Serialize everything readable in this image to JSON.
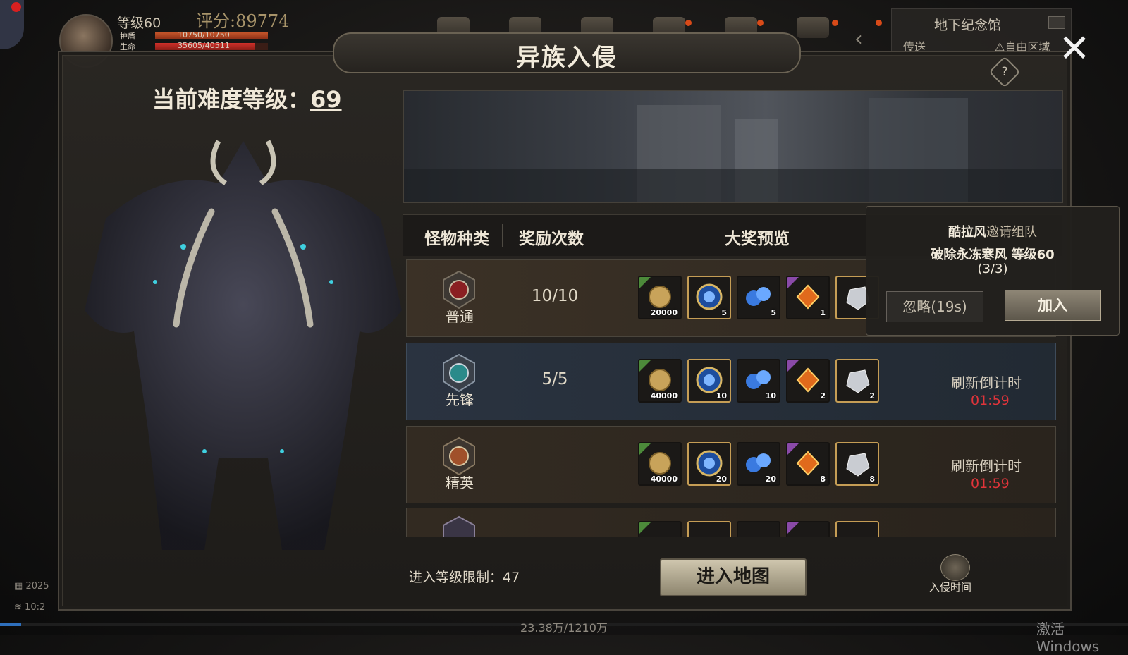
{
  "hud": {
    "level": "等级60",
    "score": "评分:89774",
    "shield_label": "护盾",
    "shield_value": "10750/10750",
    "shield_fraction": 1.0,
    "hp_label": "生命",
    "hp_value": "35605/40511",
    "hp_fraction": 0.879,
    "map_title": "地下纪念馆",
    "teleport": "传送",
    "pvp_zone": "自由区域",
    "date_partial": "2025",
    "time_partial": "10:2"
  },
  "panel": {
    "title": "异族入侵",
    "difficulty_label": "当前难度等级：",
    "difficulty_value": "69"
  },
  "table": {
    "headers": [
      "怪物种类",
      "奖励次数",
      "大奖预览"
    ],
    "rows": [
      {
        "name": "普通",
        "count": "10/10",
        "emblem_color": "#8a1f22",
        "items": [
          {
            "icon": "gold-coin-icon",
            "qty": "20000"
          },
          {
            "icon": "blue-orb-ring-icon",
            "qty": "5"
          },
          {
            "icon": "blue-orbs-icon",
            "qty": "5"
          },
          {
            "icon": "fire-gem-icon",
            "qty": "1"
          },
          {
            "icon": "crystal-icon",
            "qty": ""
          }
        ]
      },
      {
        "name": "先锋",
        "count": "5/5",
        "emblem_color": "#2a8a8a",
        "items": [
          {
            "icon": "gold-coin-icon",
            "qty": "40000"
          },
          {
            "icon": "blue-orb-ring-icon",
            "qty": "10"
          },
          {
            "icon": "blue-orbs-icon",
            "qty": "10"
          },
          {
            "icon": "fire-gem-icon",
            "qty": "2"
          },
          {
            "icon": "crystal-icon",
            "qty": "2"
          }
        ],
        "refresh_label": "刷新倒计时",
        "refresh_time": "01:59"
      },
      {
        "name": "精英",
        "count": "",
        "emblem_color": "#a0502a",
        "items": [
          {
            "icon": "gold-coin-icon",
            "qty": "40000"
          },
          {
            "icon": "blue-orb-ring-icon",
            "qty": "20"
          },
          {
            "icon": "blue-orbs-icon",
            "qty": "20"
          },
          {
            "icon": "fire-gem-icon",
            "qty": "8"
          },
          {
            "icon": "crystal-icon",
            "qty": "8"
          }
        ],
        "refresh_label": "刷新倒计时",
        "refresh_time": "01:59"
      }
    ]
  },
  "invite": {
    "inviter": "酷拉风",
    "text": "邀请组队",
    "mission": "破除永冻寒风 等级60",
    "members": "(3/3)",
    "ignore_label": "忽略(19s)",
    "join_label": "加入"
  },
  "footer": {
    "level_limit": "进入等级限制：47",
    "enter_map": "进入地图",
    "invade_time": "入侵时间",
    "exp_text": "23.38万/1210万",
    "exp_fraction": 0.019
  },
  "system": {
    "watermark": "激活 Windows"
  }
}
